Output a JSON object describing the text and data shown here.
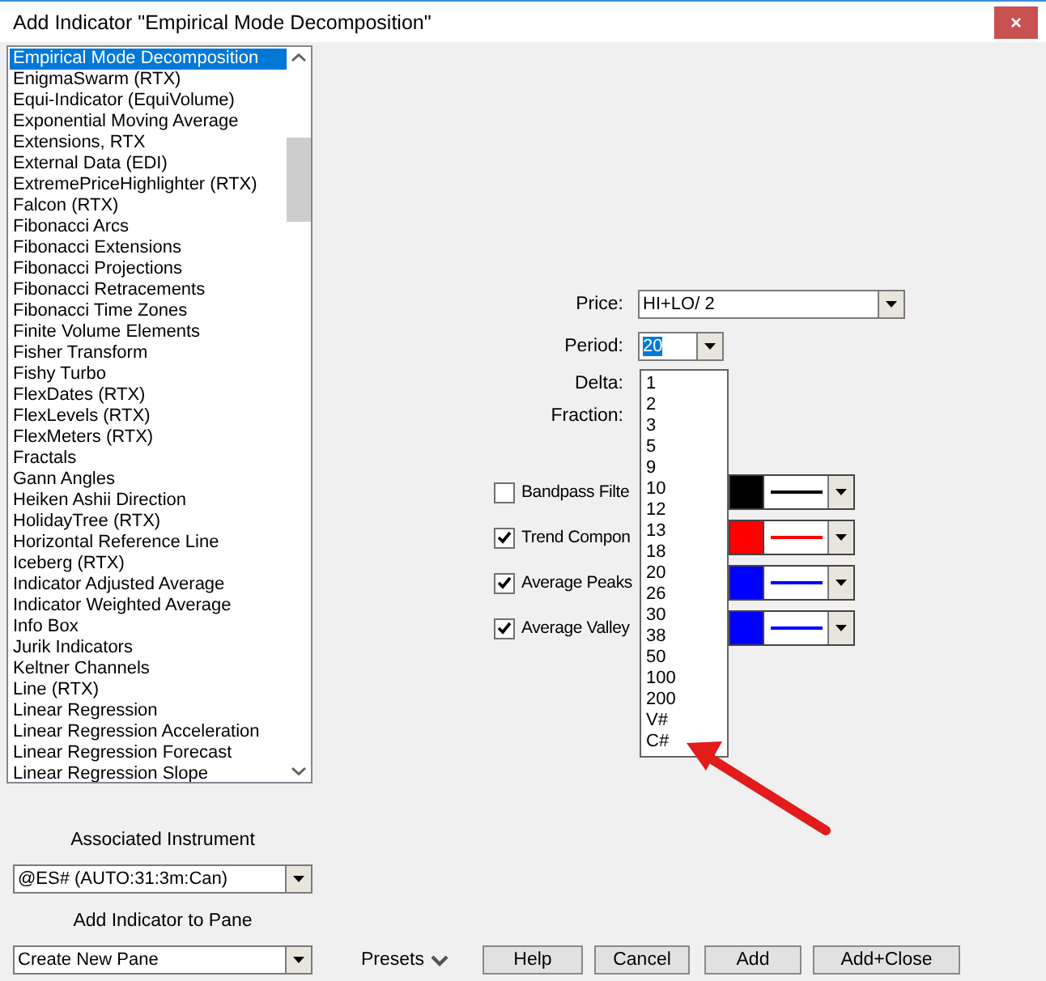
{
  "window": {
    "title": "Add Indicator \"Empirical Mode Decomposition\"",
    "close": "×"
  },
  "indicators": [
    {
      "label": "Empirical Mode Decomposition",
      "selected": true
    },
    {
      "label": "EnigmaSwarm (RTX)",
      "selected": false
    },
    {
      "label": "Equi-Indicator (EquiVolume)",
      "selected": false
    },
    {
      "label": "Exponential Moving Average",
      "selected": false
    },
    {
      "label": "Extensions, RTX",
      "selected": false
    },
    {
      "label": "External Data (EDI)",
      "selected": false
    },
    {
      "label": "ExtremePriceHighlighter (RTX)",
      "selected": false
    },
    {
      "label": "Falcon (RTX)",
      "selected": false
    },
    {
      "label": "Fibonacci Arcs",
      "selected": false
    },
    {
      "label": "Fibonacci Extensions",
      "selected": false
    },
    {
      "label": "Fibonacci Projections",
      "selected": false
    },
    {
      "label": "Fibonacci Retracements",
      "selected": false
    },
    {
      "label": "Fibonacci Time Zones",
      "selected": false
    },
    {
      "label": "Finite Volume Elements",
      "selected": false
    },
    {
      "label": "Fisher Transform",
      "selected": false
    },
    {
      "label": "Fishy Turbo",
      "selected": false
    },
    {
      "label": "FlexDates (RTX)",
      "selected": false
    },
    {
      "label": "FlexLevels (RTX)",
      "selected": false
    },
    {
      "label": "FlexMeters (RTX)",
      "selected": false
    },
    {
      "label": "Fractals",
      "selected": false
    },
    {
      "label": "Gann Angles",
      "selected": false
    },
    {
      "label": "Heiken Ashii Direction",
      "selected": false
    },
    {
      "label": "HolidayTree (RTX)",
      "selected": false
    },
    {
      "label": "Horizontal Reference Line",
      "selected": false
    },
    {
      "label": "Iceberg (RTX)",
      "selected": false
    },
    {
      "label": "Indicator Adjusted Average",
      "selected": false
    },
    {
      "label": "Indicator Weighted Average",
      "selected": false
    },
    {
      "label": "Info Box",
      "selected": false
    },
    {
      "label": "Jurik Indicators",
      "selected": false
    },
    {
      "label": "Keltner Channels",
      "selected": false
    },
    {
      "label": "Line (RTX)",
      "selected": false
    },
    {
      "label": "Linear Regression",
      "selected": false
    },
    {
      "label": "Linear Regression Acceleration",
      "selected": false
    },
    {
      "label": "Linear Regression Forecast",
      "selected": false
    },
    {
      "label": "Linear Regression Slope",
      "selected": false
    }
  ],
  "price": {
    "label": "Price:",
    "value": "HI+LO/ 2"
  },
  "period": {
    "label": "Period:",
    "value": "20",
    "highlighted": true,
    "options": [
      "1",
      "2",
      "3",
      "5",
      "9",
      "10",
      "12",
      "13",
      "18",
      "20",
      "26",
      "30",
      "38",
      "50",
      "100",
      "200",
      "V#",
      "C#"
    ]
  },
  "delta": {
    "label": "Delta:"
  },
  "fraction": {
    "label": "Fraction:"
  },
  "plots": [
    {
      "label": "Bandpass Filte",
      "checked": false,
      "color": "#000000"
    },
    {
      "label": "Trend Compon",
      "checked": true,
      "color": "#ff0000"
    },
    {
      "label": "Average Peaks",
      "checked": true,
      "color": "#0000ff"
    },
    {
      "label": "Average Valley",
      "checked": true,
      "color": "#0000ff"
    }
  ],
  "instrument": {
    "label": "Associated Instrument",
    "value": "@ES# (AUTO:31:3m:Can)"
  },
  "pane": {
    "label": "Add Indicator to Pane",
    "value": "Create New Pane"
  },
  "presets": "Presets",
  "buttons": [
    "Help",
    "Cancel",
    "Add",
    "Add+Close"
  ]
}
